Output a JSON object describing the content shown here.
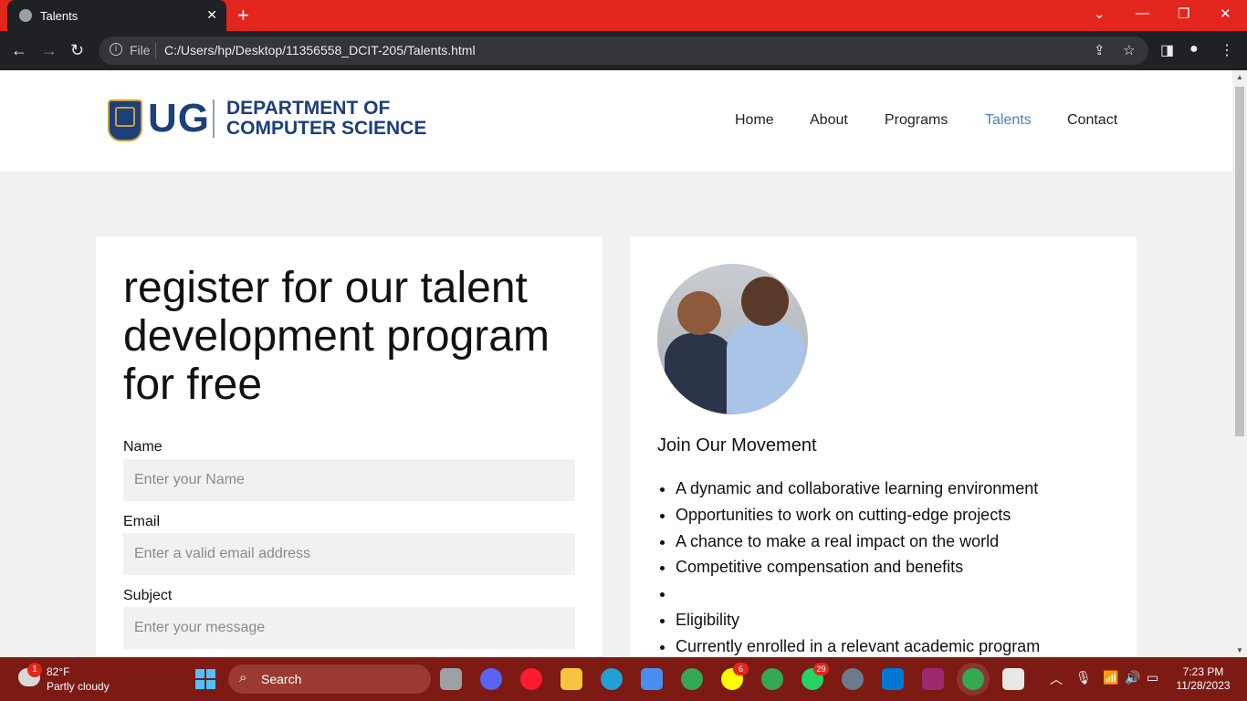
{
  "browser": {
    "tab_title": "Talents",
    "file_label": "File",
    "url": "C:/Users/hp/Desktop/11356558_DCIT-205/Talents.html"
  },
  "site": {
    "logo_ug": "UG",
    "logo_dept_line1": "DEPARTMENT OF",
    "logo_dept_line2": "COMPUTER SCIENCE",
    "nav": [
      {
        "label": "Home",
        "active": false
      },
      {
        "label": "About",
        "active": false
      },
      {
        "label": "Programs",
        "active": false
      },
      {
        "label": "Talents",
        "active": true
      },
      {
        "label": "Contact",
        "active": false
      }
    ],
    "active_color": "#4a7fb5"
  },
  "form": {
    "headline": "register for our talent development program for free",
    "name_label": "Name",
    "name_placeholder": "Enter your Name",
    "email_label": "Email",
    "email_placeholder": "Enter a valid email address",
    "subject_label": "Subject",
    "subject_placeholder": "Enter your message"
  },
  "info": {
    "heading": "Join Our Movement",
    "items": [
      "A dynamic and collaborative learning environment",
      "Opportunities to work on cutting-edge projects",
      "A chance to make a real impact on the world",
      "Competitive compensation and benefits",
      "",
      "Eligibility",
      "Currently enrolled in a relevant academic program"
    ]
  },
  "taskbar": {
    "weather_badge": "1",
    "temperature": "82°F",
    "condition": "Partly cloudy",
    "search_label": "Search",
    "badge_snapchat": "6",
    "badge_whatsapp": "29",
    "time": "7:23 PM",
    "date": "11/28/2023"
  }
}
